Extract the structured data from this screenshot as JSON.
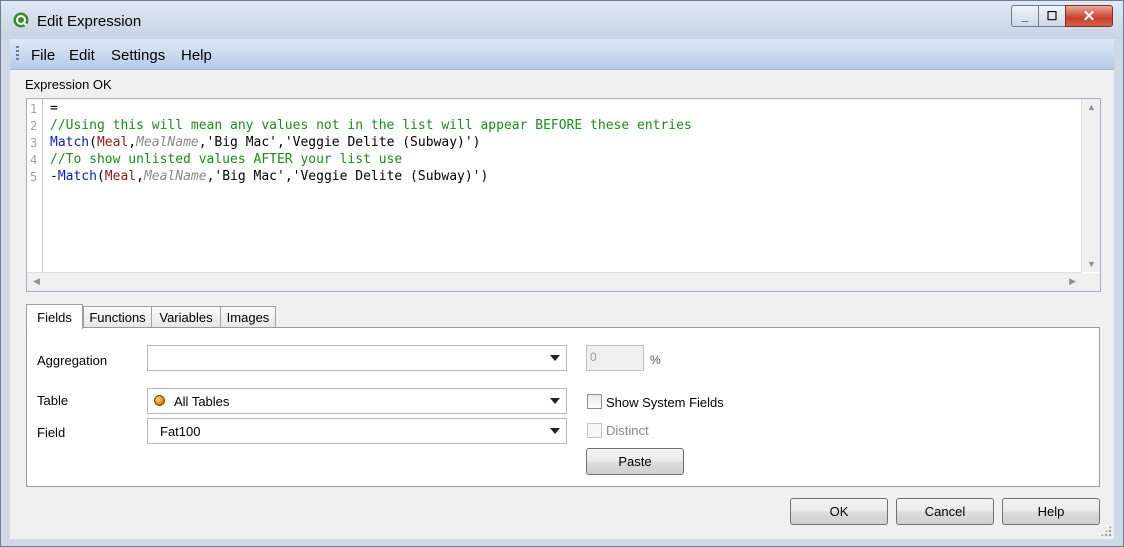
{
  "window": {
    "title": "Edit Expression",
    "minimize_symbol": "_",
    "maximize_symbol": "☐",
    "close_symbol": "✕"
  },
  "menu": {
    "items": [
      "File",
      "Edit",
      "Settings",
      "Help"
    ]
  },
  "status": "Expression OK",
  "editor": {
    "line_numbers": [
      "1",
      "2",
      "3",
      "4",
      "5"
    ],
    "lines": [
      [
        {
          "t": "=",
          "c": "plain"
        }
      ],
      [
        {
          "t": "//Using this will mean any values not in the list will appear BEFORE these entries",
          "c": "comment"
        }
      ],
      [
        {
          "t": "Match",
          "c": "function"
        },
        {
          "t": "(",
          "c": "plain"
        },
        {
          "t": "Meal",
          "c": "field"
        },
        {
          "t": ",",
          "c": "plain"
        },
        {
          "t": "MealName",
          "c": "variable"
        },
        {
          "t": ",'Big Mac','Veggie Delite (Subway)')",
          "c": "plain"
        }
      ],
      [
        {
          "t": "//To show unlisted values AFTER your list use",
          "c": "comment"
        }
      ],
      [
        {
          "t": "-",
          "c": "plain"
        },
        {
          "t": "Match",
          "c": "function"
        },
        {
          "t": "(",
          "c": "plain"
        },
        {
          "t": "Meal",
          "c": "field"
        },
        {
          "t": ",",
          "c": "plain"
        },
        {
          "t": "MealName",
          "c": "variable"
        },
        {
          "t": ",'Big Mac','Veggie Delite (Subway)')",
          "c": "plain"
        }
      ]
    ]
  },
  "tabs": [
    "Fields",
    "Functions",
    "Variables",
    "Images"
  ],
  "fields_panel": {
    "aggregation_label": "Aggregation",
    "aggregation_value": "",
    "percent_value": "0",
    "percent_symbol": "%",
    "table_label": "Table",
    "table_value": "All Tables",
    "field_label": "Field",
    "field_value": "Fat100",
    "show_system_fields_label": "Show System Fields",
    "distinct_label": "Distinct",
    "paste_label": "Paste"
  },
  "buttons": {
    "ok": "OK",
    "cancel": "Cancel",
    "help": "Help"
  },
  "colors": {
    "comment": "#1e8b1e",
    "function": "#0a1db5",
    "field": "#8b1a1a",
    "variable": "#8a8a8a",
    "menubar": "#c8d9f0"
  }
}
